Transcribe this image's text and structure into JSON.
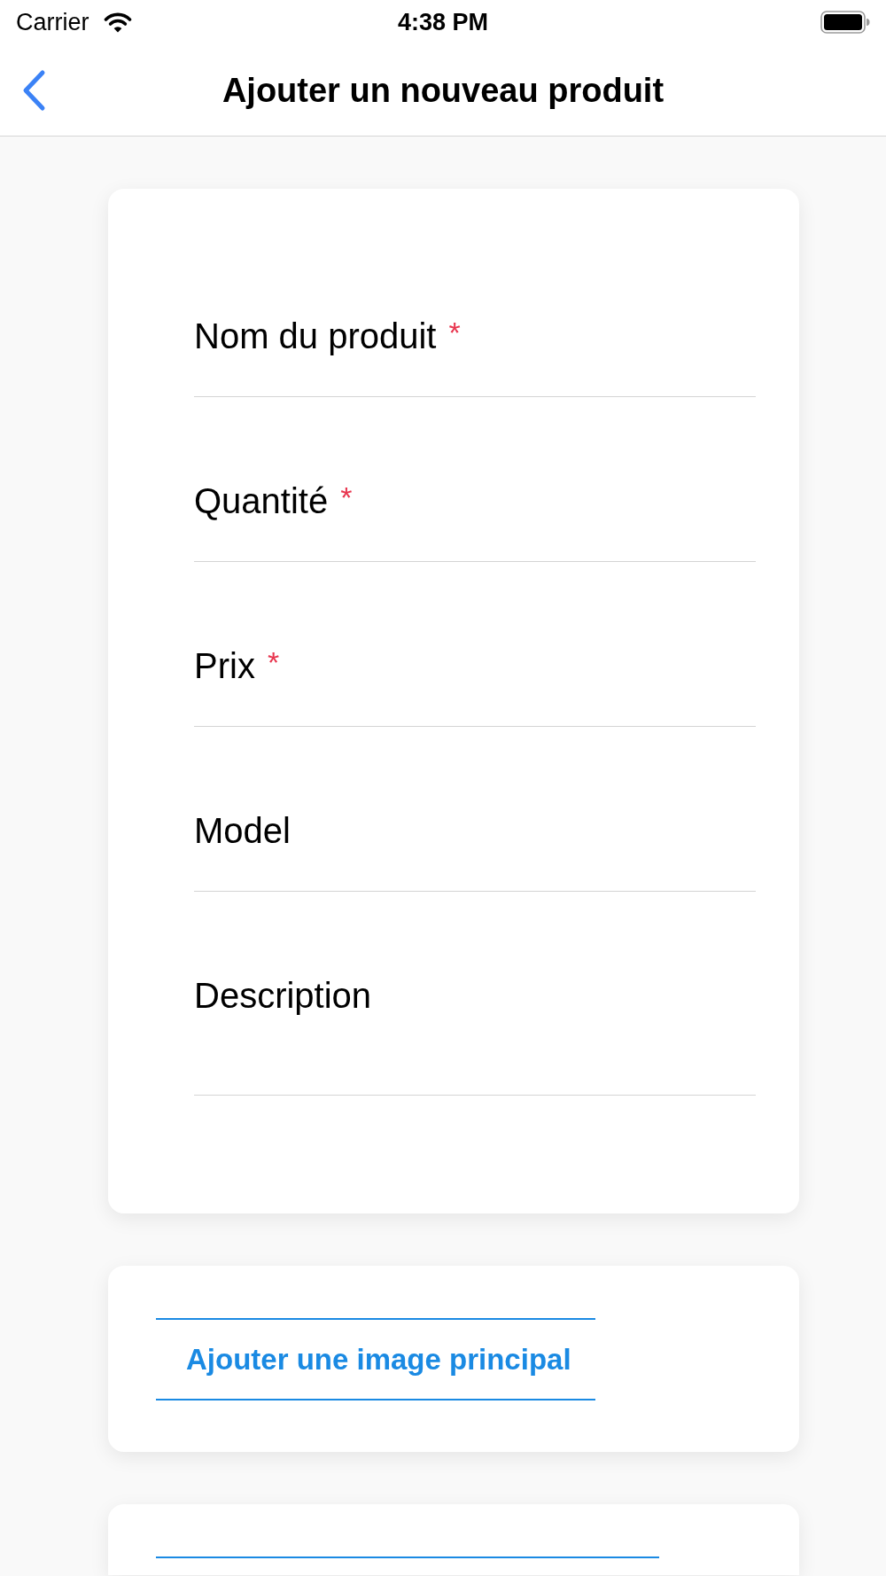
{
  "status_bar": {
    "carrier": "Carrier",
    "time": "4:38 PM"
  },
  "nav_bar": {
    "title": "Ajouter un nouveau produit"
  },
  "form": {
    "fields": [
      {
        "kind": "text",
        "label": "Nom du produit",
        "required_mark": "*"
      },
      {
        "kind": "text",
        "label": "Quantité",
        "required_mark": "*"
      },
      {
        "kind": "text",
        "label": "Prix",
        "required_mark": "*"
      },
      {
        "kind": "text",
        "label": "Model"
      },
      {
        "kind": "multiline",
        "label": "Description"
      }
    ]
  },
  "image_button": {
    "label": "Ajouter une image principal"
  }
}
